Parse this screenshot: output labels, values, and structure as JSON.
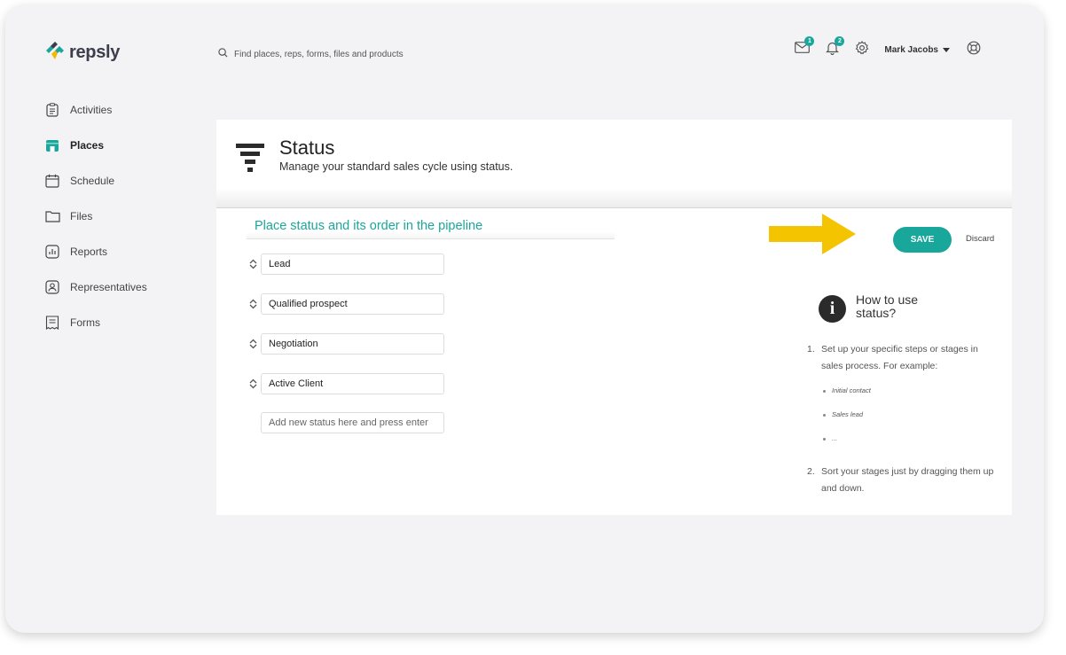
{
  "app": {
    "brand": "repsly",
    "search_placeholder": "Find places, reps, forms, files and products",
    "messages_count": "1",
    "notifications_count": "2",
    "user_name": "Mark Jacobs",
    "accent_color": "#1aa79b"
  },
  "sidebar": {
    "items": [
      {
        "label": "Activities",
        "icon": "clipboard-icon"
      },
      {
        "label": "Places",
        "icon": "store-icon",
        "active": true
      },
      {
        "label": "Schedule",
        "icon": "calendar-icon"
      },
      {
        "label": "Files",
        "icon": "folder-icon"
      },
      {
        "label": "Reports",
        "icon": "bar-chart-icon"
      },
      {
        "label": "Representatives",
        "icon": "person-badge-icon"
      },
      {
        "label": "Forms",
        "icon": "form-icon"
      }
    ]
  },
  "page": {
    "title": "Status",
    "subtitle": "Manage your standard sales cycle using status.",
    "section_title": "Place status and its order in the pipeline",
    "statuses": [
      "Lead",
      "Qualified prospect",
      "Negotiation",
      "Active Client"
    ],
    "add_placeholder": "Add new status here and press enter",
    "save_label": "SAVE",
    "discard_label": "Discard"
  },
  "help": {
    "title": "How to use status?",
    "step1_num": "1.",
    "step1": "Set up your specific steps or stages in sales process. For example:",
    "examples": [
      "Initial contact",
      "Sales lead",
      "..."
    ],
    "step2_num": "2.",
    "step2": "Sort your stages just by dragging them up and down."
  }
}
